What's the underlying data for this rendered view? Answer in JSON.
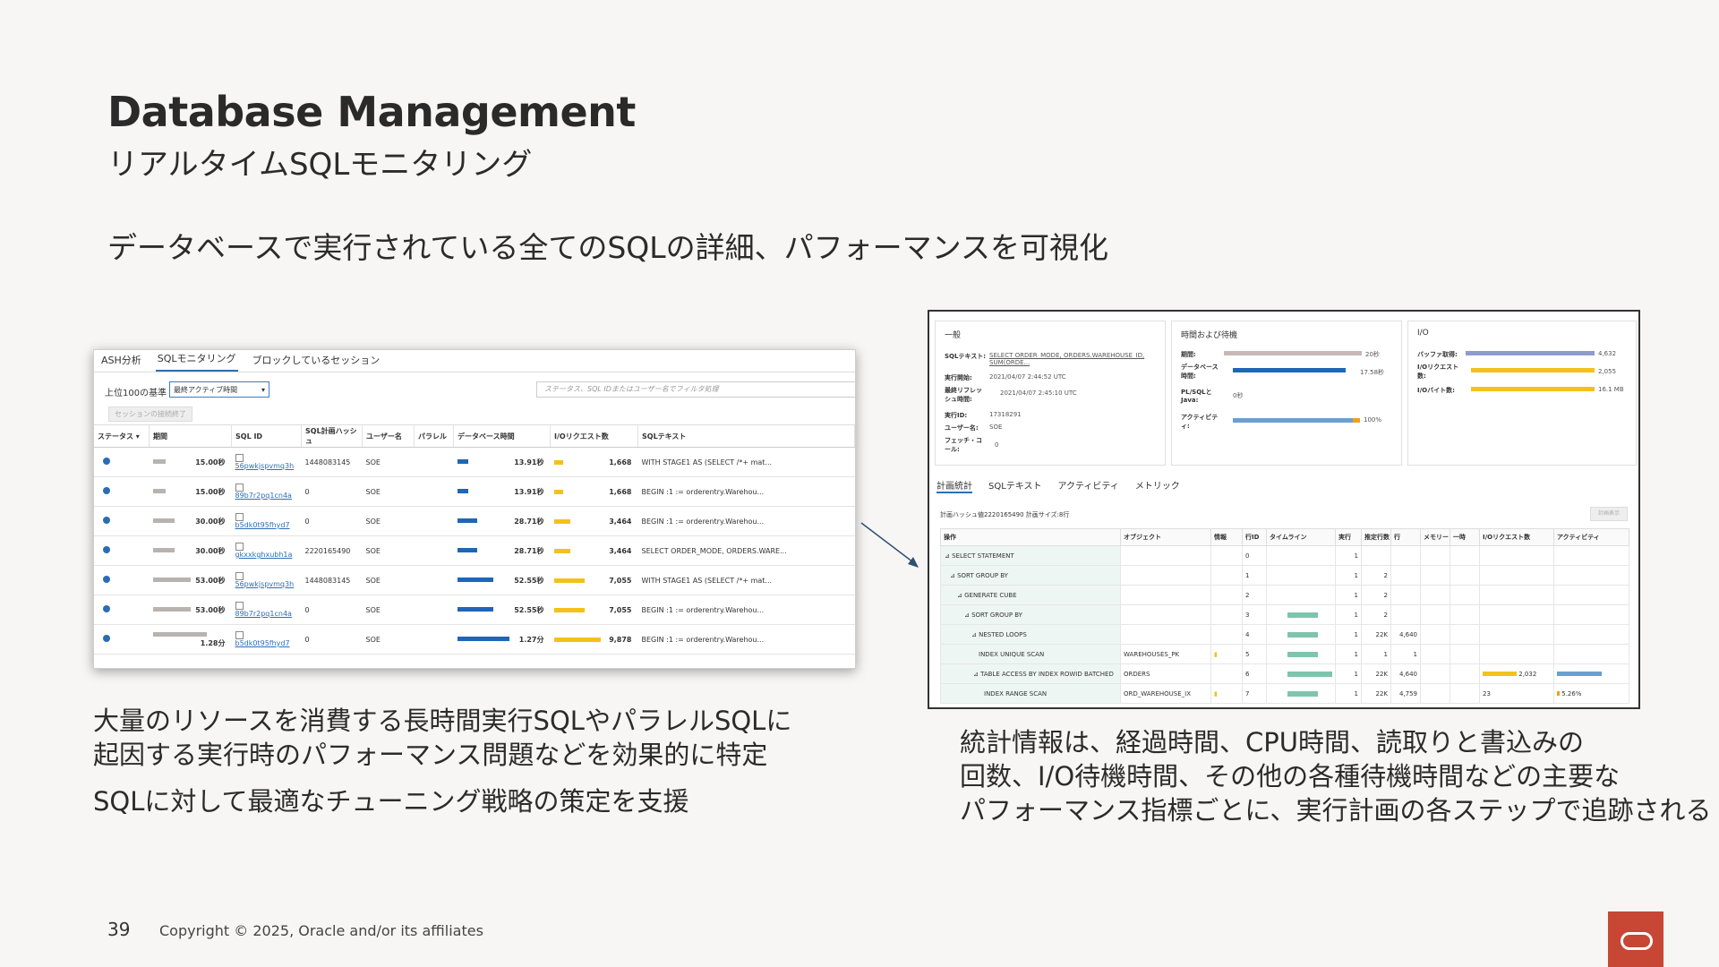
{
  "slide": {
    "title": "Database Management",
    "subtitle": "リアルタイムSQLモニタリング",
    "lead": "データベースで実行されている全てのSQLの詳細、パフォーマンスを可視化",
    "caption_left_1a": "大量のリソースを消費する長時間実行SQLやパラレルSQLに",
    "caption_left_1b": "起因する実行時のパフォーマンス問題などを効果的に特定",
    "caption_left_2": "SQLに対して最適なチューニング戦略の策定を支援",
    "caption_right_a": "統計情報は、経過時間、CPU時間、読取りと書込みの",
    "caption_right_b": "回数、I/O待機時間、その他の各種待機時間などの主要な",
    "caption_right_c": "パフォーマンス指標ごとに、実行計画の各ステップで追跡される",
    "page_number": "39",
    "copyright": "Copyright © 2025, Oracle and/or its affiliates"
  },
  "left_shot": {
    "tabs": [
      "ASH分析",
      "SQLモニタリング",
      "ブロックしているセッション"
    ],
    "top_label": "上位100の基準",
    "select_value": "最終アクティブ時間",
    "search_placeholder": "ステータス、SQL IDまたはユーザー名でフィルタ処理",
    "end_button": "セッションの接続終了",
    "columns": [
      "ステータス",
      "期間",
      "SQL ID",
      "SQL計画ハッシュ",
      "ユーザー名",
      "パラレル",
      "データベース時間",
      "I/Oリクエスト数",
      "SQLテキスト"
    ],
    "rows": [
      {
        "duration": "15.00秒",
        "sql_id": "56pwkjspvmq3h",
        "hash": "1448083145",
        "user": "SOE",
        "dbtime": "13.91秒",
        "io": "1,668",
        "text": "WITH STAGE1 AS (SELECT /*+ mat..."
      },
      {
        "duration": "15.00秒",
        "sql_id": "89b7r2pq1cn4a",
        "hash": "0",
        "user": "SOE",
        "dbtime": "13.91秒",
        "io": "1,668",
        "text": "BEGIN :1 := orderentry.Warehou..."
      },
      {
        "duration": "30.00秒",
        "sql_id": "b5dk0t95fhyd7",
        "hash": "0",
        "user": "SOE",
        "dbtime": "28.71秒",
        "io": "3,464",
        "text": "BEGIN :1 := orderentry.Warehou..."
      },
      {
        "duration": "30.00秒",
        "sql_id": "gkxxkghxubh1a",
        "hash": "2220165490",
        "user": "SOE",
        "dbtime": "28.71秒",
        "io": "3,464",
        "text": "SELECT ORDER_MODE, ORDERS.WARE..."
      },
      {
        "duration": "53.00秒",
        "sql_id": "56pwkjspvmq3h",
        "hash": "1448083145",
        "user": "SOE",
        "dbtime": "52.55秒",
        "io": "7,055",
        "text": "WITH STAGE1 AS (SELECT /*+ mat..."
      },
      {
        "duration": "53.00秒",
        "sql_id": "89b7r2pq1cn4a",
        "hash": "0",
        "user": "SOE",
        "dbtime": "52.55秒",
        "io": "7,055",
        "text": "BEGIN :1 := orderentry.Warehou..."
      },
      {
        "duration": "1.28分",
        "sql_id": "b5dk0t95fhyd7",
        "hash": "0",
        "user": "SOE",
        "dbtime": "1.27分",
        "io": "9,878",
        "text": "BEGIN :1 := orderentry.Warehou..."
      }
    ]
  },
  "right_shot": {
    "general": {
      "header": "一般",
      "sql_text_label": "SQLテキスト:",
      "sql_text": "SELECT ORDER_MODE, ORDERS.WAREHOUSE_ID, SUM(ORDE...",
      "start_label": "実行開始:",
      "start": "2021/04/07 2:44:52 UTC",
      "refresh_label": "最終リフレッシュ時間:",
      "refresh": "2021/04/07 2:45:10 UTC",
      "exec_label": "実行ID:",
      "exec": "17318291",
      "user_label": "ユーザー名:",
      "user": "SOE",
      "fetch_label": "フェッチ・コール:",
      "fetch": "0"
    },
    "time": {
      "header": "時間および待機",
      "duration_label": "期間:",
      "duration": "20秒",
      "dbtime_label": "データベース時間:",
      "dbtime": "17.58秒",
      "plsql_label": "PL/SQLとJava:",
      "plsql": "0秒",
      "activity_label": "アクティビティ:",
      "activity": "100%"
    },
    "io": {
      "header": "I/O",
      "buffer_label": "バッファ取得:",
      "buffer": "4,632",
      "ioreq_label": "I/Oリクエスト数:",
      "ioreq": "2,055",
      "iobytes_label": "I/Oバイト数:",
      "iobytes": "16.1 MB"
    },
    "tabs": [
      "計画統計",
      "SQLテキスト",
      "アクティビティ",
      "メトリック"
    ],
    "plan_info": "計画ハッシュ値2220165490   計画サイズ:8行",
    "plan_button": "計画表示",
    "columns": [
      "操作",
      "オブジェクト",
      "情報",
      "行ID",
      "タイムライン",
      "実行",
      "推定行数",
      "行",
      "メモリー",
      "一時",
      "I/Oリクエスト数",
      "アクティビティ"
    ],
    "rows": [
      {
        "op": "⊿ SELECT STATEMENT",
        "obj": "",
        "id": "0",
        "exec": "1",
        "est": "",
        "rows": "",
        "io": "",
        "act": ""
      },
      {
        "op": "⊿ SORT GROUP BY",
        "obj": "",
        "id": "1",
        "exec": "1",
        "est": "2",
        "rows": "",
        "io": "",
        "act": ""
      },
      {
        "op": "⊿ GENERATE CUBE",
        "obj": "",
        "id": "2",
        "exec": "1",
        "est": "2",
        "rows": "",
        "io": "",
        "act": ""
      },
      {
        "op": "⊿ SORT GROUP BY",
        "obj": "",
        "id": "3",
        "exec": "1",
        "est": "2",
        "rows": "",
        "io": "",
        "act": ""
      },
      {
        "op": "⊿ NESTED LOOPS",
        "obj": "",
        "id": "4",
        "exec": "1",
        "est": "22K",
        "rows": "4,640",
        "io": "",
        "act": ""
      },
      {
        "op": "INDEX UNIQUE SCAN",
        "obj": "WAREHOUSES_PK",
        "id": "5",
        "exec": "1",
        "est": "1",
        "rows": "1",
        "io": "",
        "act": ""
      },
      {
        "op": "⊿ TABLE ACCESS BY INDEX ROWID BATCHED",
        "obj": "ORDERS",
        "id": "6",
        "exec": "1",
        "est": "22K",
        "rows": "4,640",
        "io": "2,032",
        "act": ""
      },
      {
        "op": "INDEX RANGE SCAN",
        "obj": "ORD_WAREHOUSE_IX",
        "id": "7",
        "exec": "1",
        "est": "22K",
        "rows": "4,759",
        "io": "23",
        "act": "5.26%"
      }
    ]
  }
}
